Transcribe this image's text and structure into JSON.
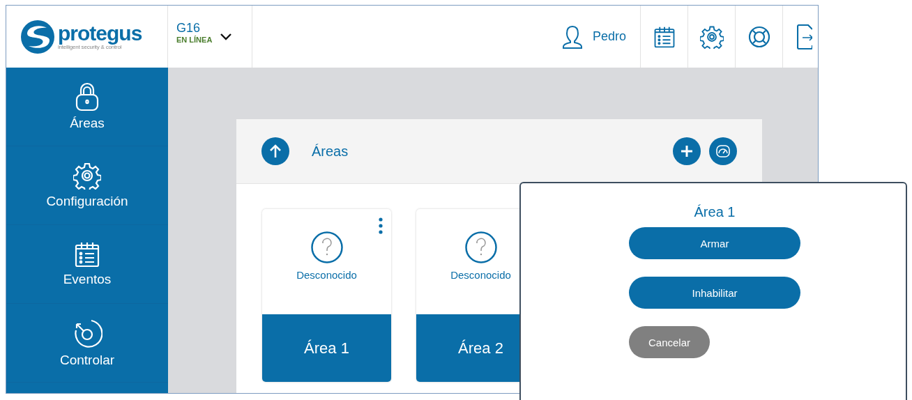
{
  "logo": {
    "name": "protegus",
    "tagline": "intelligent security & control"
  },
  "device": {
    "name": "G16",
    "status": "EN LÍNEA",
    "expanded": false
  },
  "user": {
    "name": "Pedro"
  },
  "sidebar": {
    "items": [
      {
        "label": "Áreas",
        "kind": "lock"
      },
      {
        "label": "Configuración",
        "kind": "gear"
      },
      {
        "label": "Eventos",
        "kind": "calendar"
      },
      {
        "label": "Controlar",
        "kind": "dial"
      }
    ]
  },
  "panel": {
    "title": "Áreas",
    "areas": [
      {
        "name": "Área 1",
        "status": "Desconocido",
        "menu": true
      },
      {
        "name": "Área 2",
        "status": "Desconocido"
      }
    ]
  },
  "dialog": {
    "title": "Área 1",
    "actions": [
      {
        "label": "Armar",
        "kind": "primary"
      },
      {
        "label": "Inhabilitar",
        "kind": "primary"
      },
      {
        "label": "Cancelar",
        "kind": "secondary"
      }
    ]
  }
}
